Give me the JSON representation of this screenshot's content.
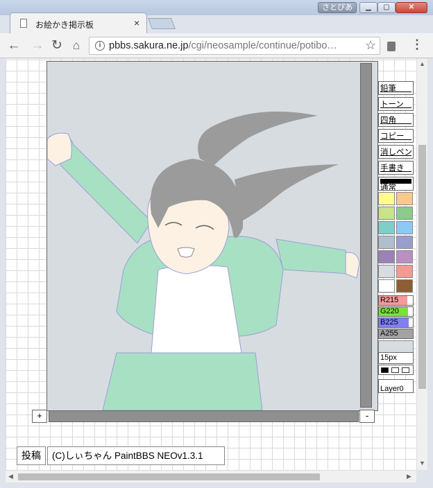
{
  "window": {
    "user_label": "さとぴあ",
    "min_glyph": "▁",
    "max_glyph": "▢",
    "close_glyph": "✕"
  },
  "tab": {
    "title": "お絵かき掲示板",
    "close_glyph": "×"
  },
  "toolbar": {
    "back_glyph": "←",
    "forward_glyph": "→",
    "reload_glyph": "↻",
    "home_glyph": "⌂",
    "info_glyph": "i",
    "url_host": "pbbs.sakura.ne.jp",
    "url_path": "/cgi/neosample/continue/potibo…",
    "star_glyph": "☆",
    "menu_glyph": "⋮"
  },
  "paint": {
    "tools": [
      "鉛筆",
      "トーン",
      "四角",
      "コピー",
      "消しペン",
      "手書き",
      "通常"
    ],
    "palette": [
      "#fffb8c",
      "#f9ca8c",
      "#c9e28c",
      "#8ccb8c",
      "#7fcfc9",
      "#8cc9f5",
      "#b1bece",
      "#9a9ecd",
      "#9a82b6",
      "#ba8fc2",
      "#d7dce1",
      "#f39a94",
      "#ffffff",
      "#8c5e31"
    ],
    "sliders": [
      {
        "label": "R215",
        "color": "#f49a9a",
        "level": 0.843
      },
      {
        "label": "G220",
        "color": "#7be03e",
        "level": 0.863
      },
      {
        "label": "B225",
        "color": "#8080f5",
        "level": 0.882
      },
      {
        "label": "A255",
        "color": "#a3a3a3",
        "level": 1.0
      }
    ],
    "current_color": "#d7dce1",
    "brush_size": "15px",
    "layer": "Layer0",
    "zoom_in": "+",
    "zoom_out": "-"
  },
  "footer": {
    "submit": "投稿",
    "credit": "(C)しぃちゃん PaintBBS NEOv1.3.1"
  },
  "scroll_glyphs": {
    "up": "▲",
    "down": "▼",
    "left": "◀",
    "right": "▶"
  }
}
